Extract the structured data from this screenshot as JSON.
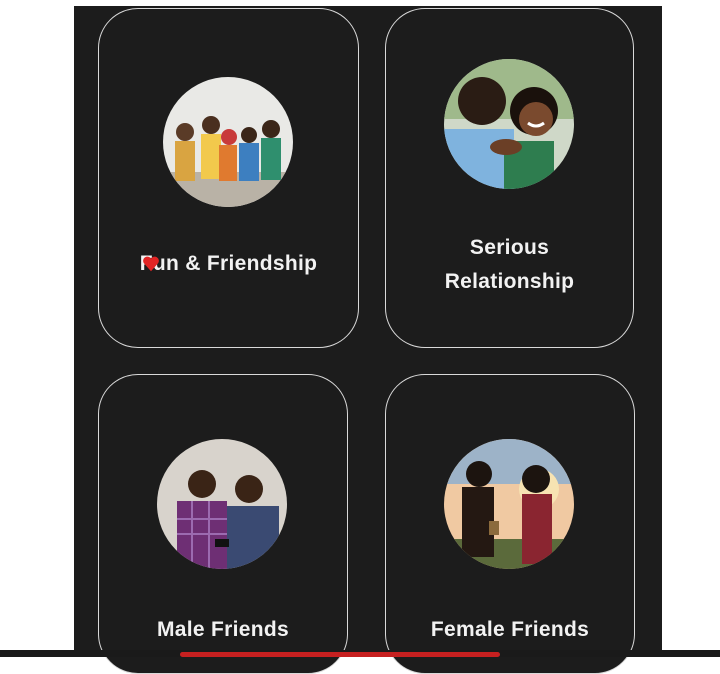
{
  "cards": [
    {
      "label": "Fun & Friendship",
      "image": "group-of-friends-photo"
    },
    {
      "label": "Serious Relationship",
      "image": "couple-hugging-photo"
    },
    {
      "label": "Male Friends",
      "image": "two-men-with-phones-photo"
    },
    {
      "label": "Female Friends",
      "image": "two-women-sunset-photo"
    }
  ],
  "colors": {
    "background": "#1c1c1c",
    "card_border": "#d9d9d9",
    "text": "#f2f2f2",
    "accent": "#e02424"
  }
}
